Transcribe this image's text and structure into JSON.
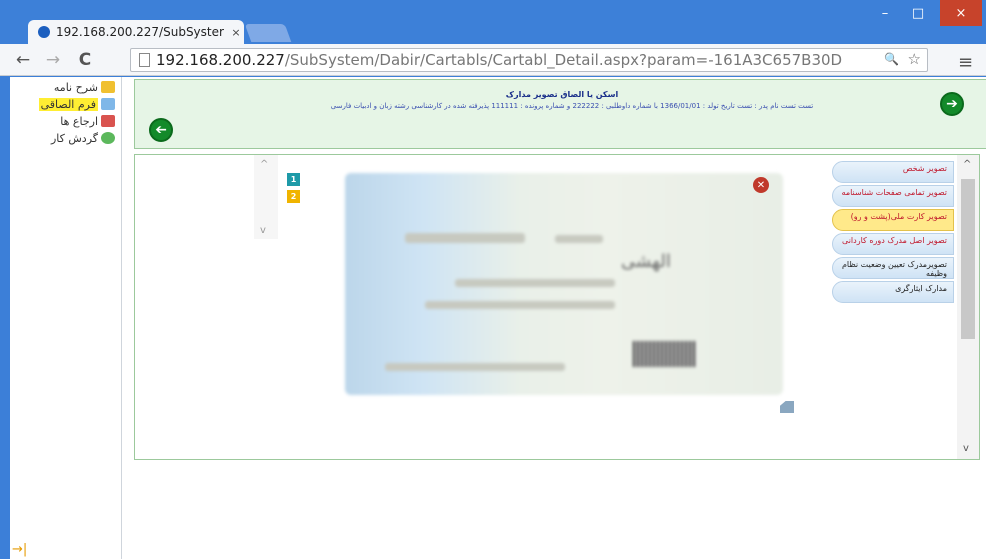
{
  "browser": {
    "tab_title": "192.168.200.227/SubSyster",
    "tab_close": "×",
    "url_host": "192.168.200.227",
    "url_path": "/SubSystem/Dabir/Cartabls/Cartabl_Detail.aspx?param=-161A3C657B30D",
    "nav_back": "←",
    "nav_forward": "→",
    "nav_reload": "C",
    "zoom_icon": "🔍",
    "star_icon": "☆",
    "menu_icon": "≡",
    "win_min": "–",
    "win_max": "□",
    "win_close": "×"
  },
  "sidebar": {
    "items": [
      {
        "label": "شرح نامه",
        "icon_color": "#f0c030"
      },
      {
        "label": "فرم الصاقی",
        "icon_color": "#7fb7e8",
        "active": true
      },
      {
        "label": "ارجاع ها",
        "icon_color": "#d9534f"
      },
      {
        "label": "گردش کار",
        "icon_color": "#5cb85c"
      }
    ],
    "corner_arrow": "→|"
  },
  "header": {
    "title": "اسکن یا الصاق تصویر مدارک",
    "subtitle": "تست تست نام پدر : تست تاریخ تولد : 1366/01/01 با شماره داوطلبی : 222222 و شماره پرونده : 111111 پذیرفته شده در کارشناسی رشته زبان و ادبیات فارسی",
    "next_arrow": "➔",
    "back_arrow": "➔"
  },
  "documents": {
    "items": [
      {
        "label": "تصویر شخص",
        "style": "normal"
      },
      {
        "label": "تصویر تمامی صفحات شناسنامه",
        "style": "normal"
      },
      {
        "label": "تصویر کارت ملی(پشت و رو)",
        "style": "selected"
      },
      {
        "label": "تصویر اصل مدرک دوره کاردانی",
        "style": "normal"
      },
      {
        "label": "تصویرمدرک تعیین وضعیت نظام وظیفه",
        "style": "dark"
      },
      {
        "label": "مدارک ایثارگری",
        "style": "dark"
      }
    ]
  },
  "viewer": {
    "close_icon": "✕",
    "card_text": "الهشی",
    "pages": [
      {
        "label": "1",
        "color": "#1e9aa8"
      },
      {
        "label": "2",
        "color": "#f0b400"
      }
    ],
    "scroll_up": "^",
    "scroll_down": "v"
  }
}
